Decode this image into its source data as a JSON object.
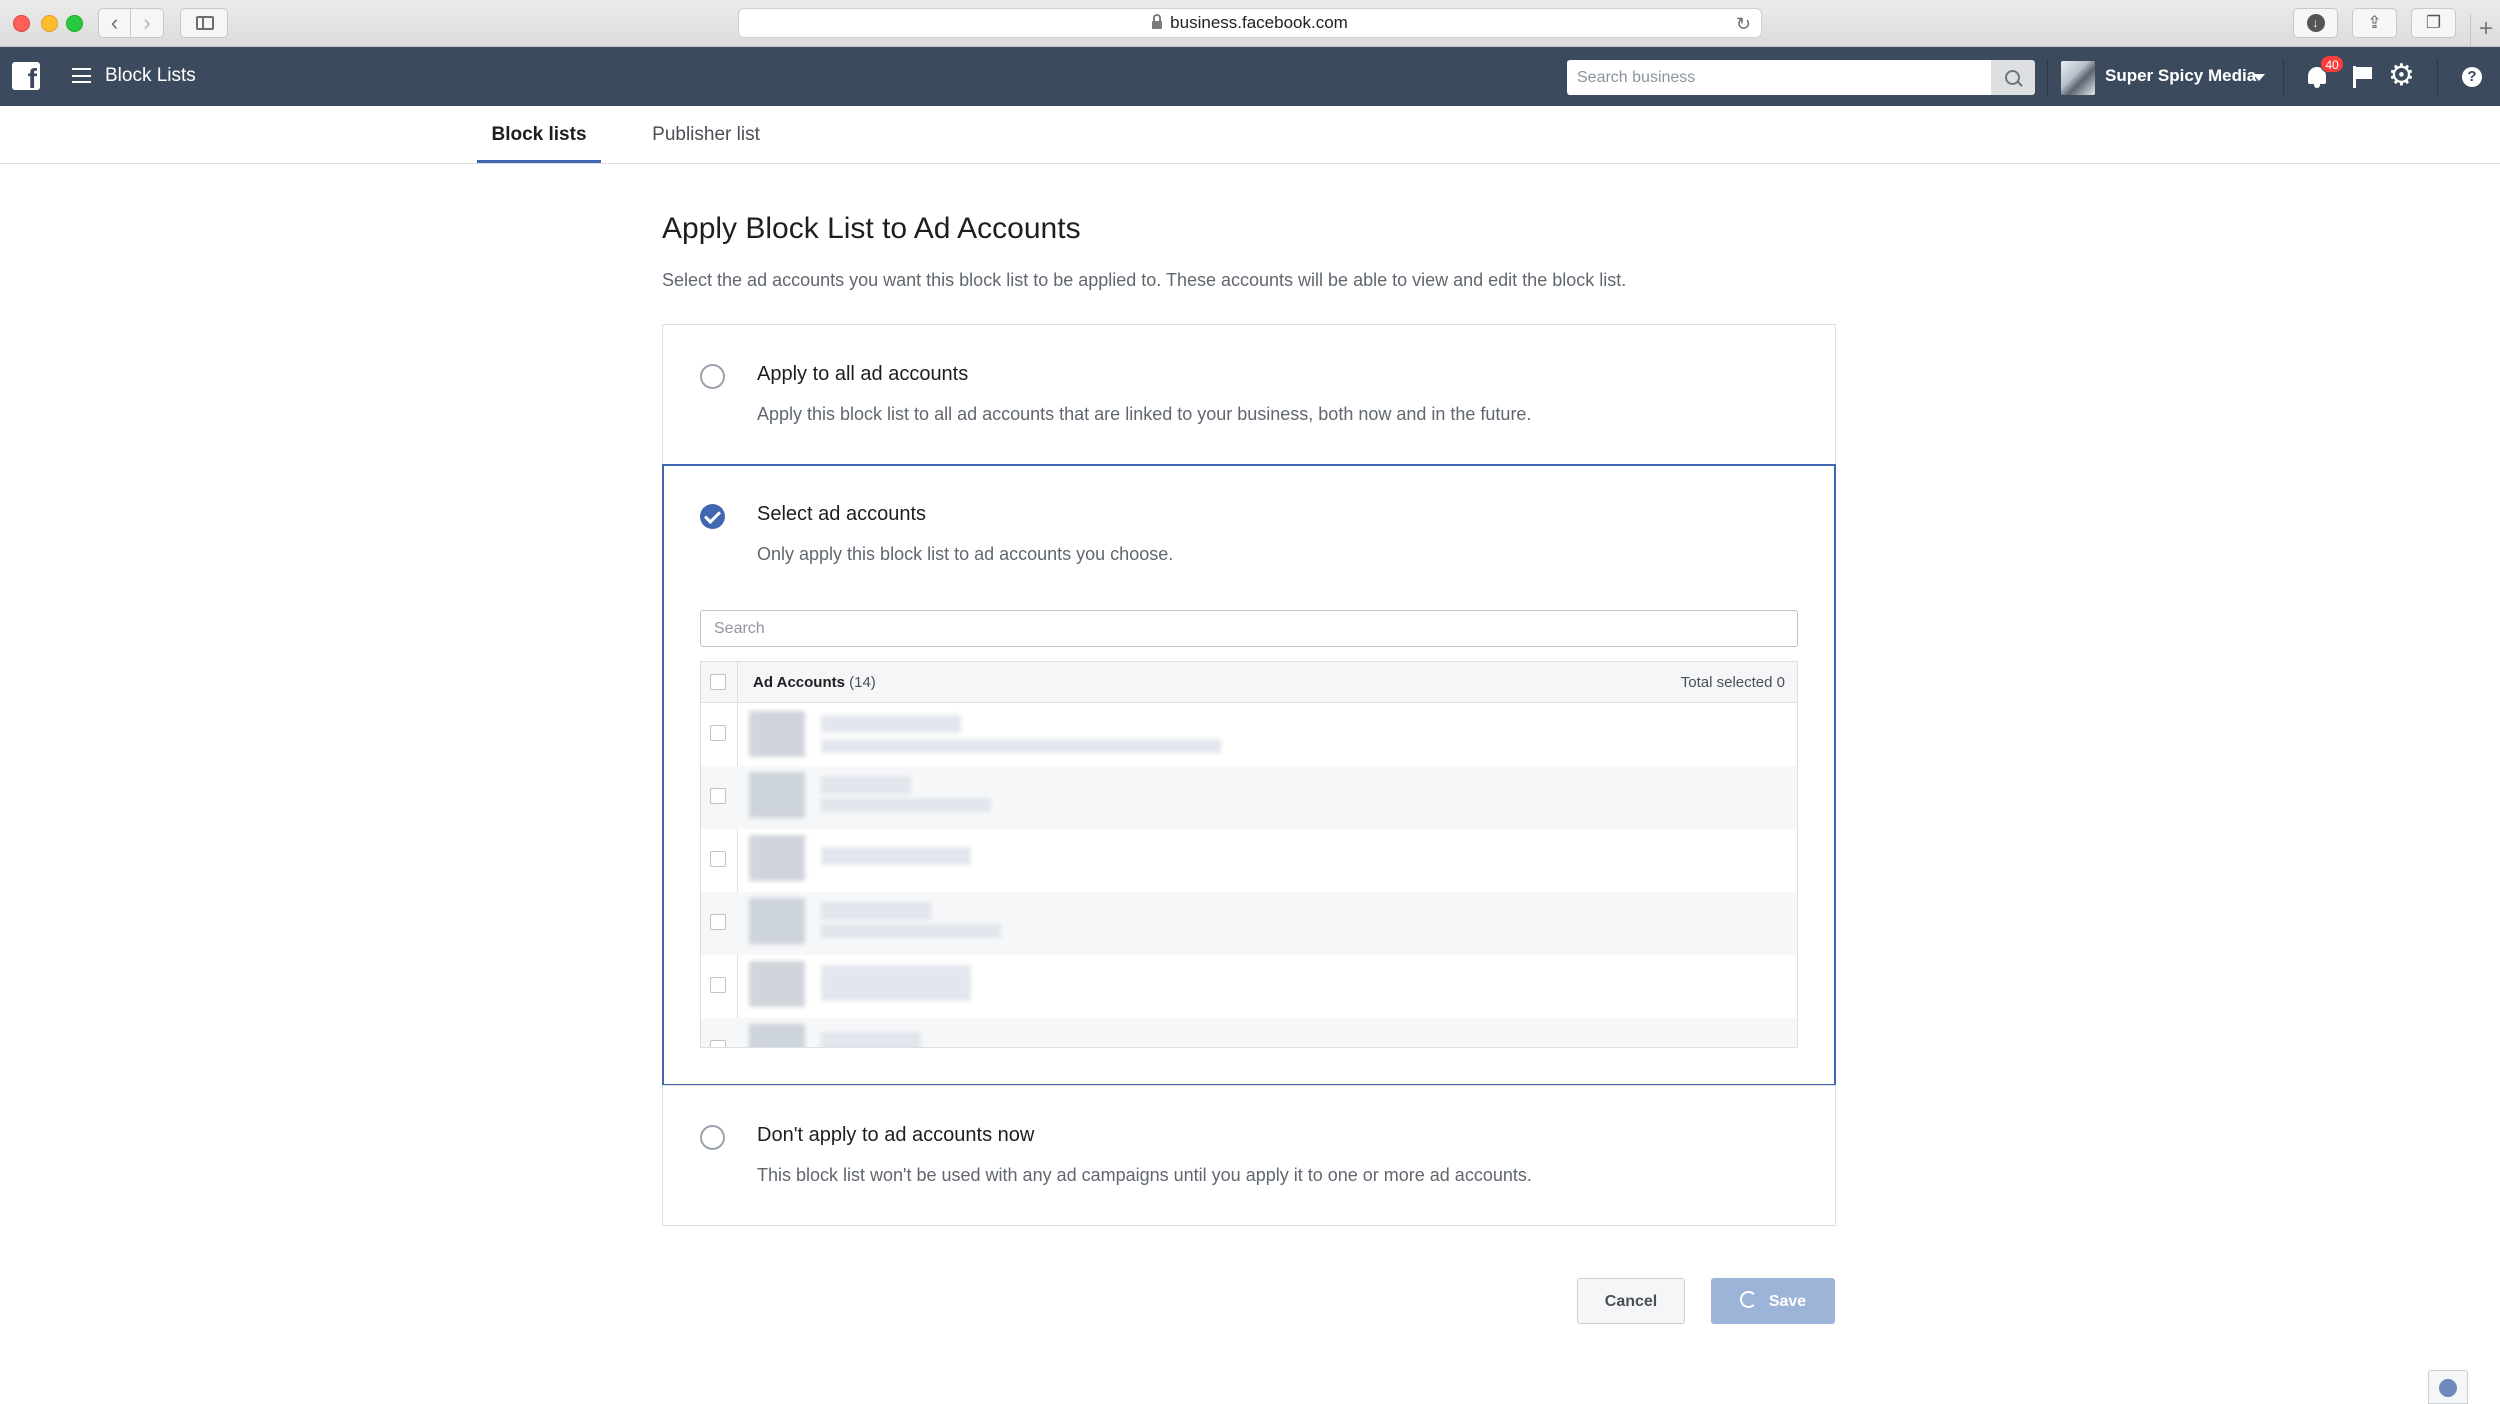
{
  "browser": {
    "url": "business.facebook.com"
  },
  "header": {
    "title": "Block Lists",
    "search_placeholder": "Search business",
    "business_name": "Super Spicy Media",
    "notification_count": "40"
  },
  "tabs": [
    {
      "label": "Block lists",
      "active": true
    },
    {
      "label": "Publisher list",
      "active": false
    }
  ],
  "main": {
    "title": "Apply Block List to Ad Accounts",
    "description": "Select the ad accounts you want this block list to be applied to. These accounts will be able to view and edit the block list."
  },
  "options": [
    {
      "title": "Apply to all ad accounts",
      "description": "Apply this block list to all ad accounts that are linked to your business, both now and in the future.",
      "selected": false
    },
    {
      "title": "Select ad accounts",
      "description": "Only apply this block list to ad accounts you choose.",
      "selected": true
    },
    {
      "title": "Don't apply to ad accounts now",
      "description": "This block list won't be used with any ad campaigns until you apply it to one or more ad accounts.",
      "selected": false
    }
  ],
  "accounts": {
    "search_placeholder": "Search",
    "header_label": "Ad Accounts",
    "count": "(14)",
    "total_selected": "Total selected 0"
  },
  "footer": {
    "cancel_label": "Cancel",
    "save_label": "Save"
  },
  "colors": {
    "fb_bar": "#3b4a5c",
    "accent": "#4267b2",
    "badge": "#fa3e3e",
    "save_disabled": "#9cb4d8"
  }
}
